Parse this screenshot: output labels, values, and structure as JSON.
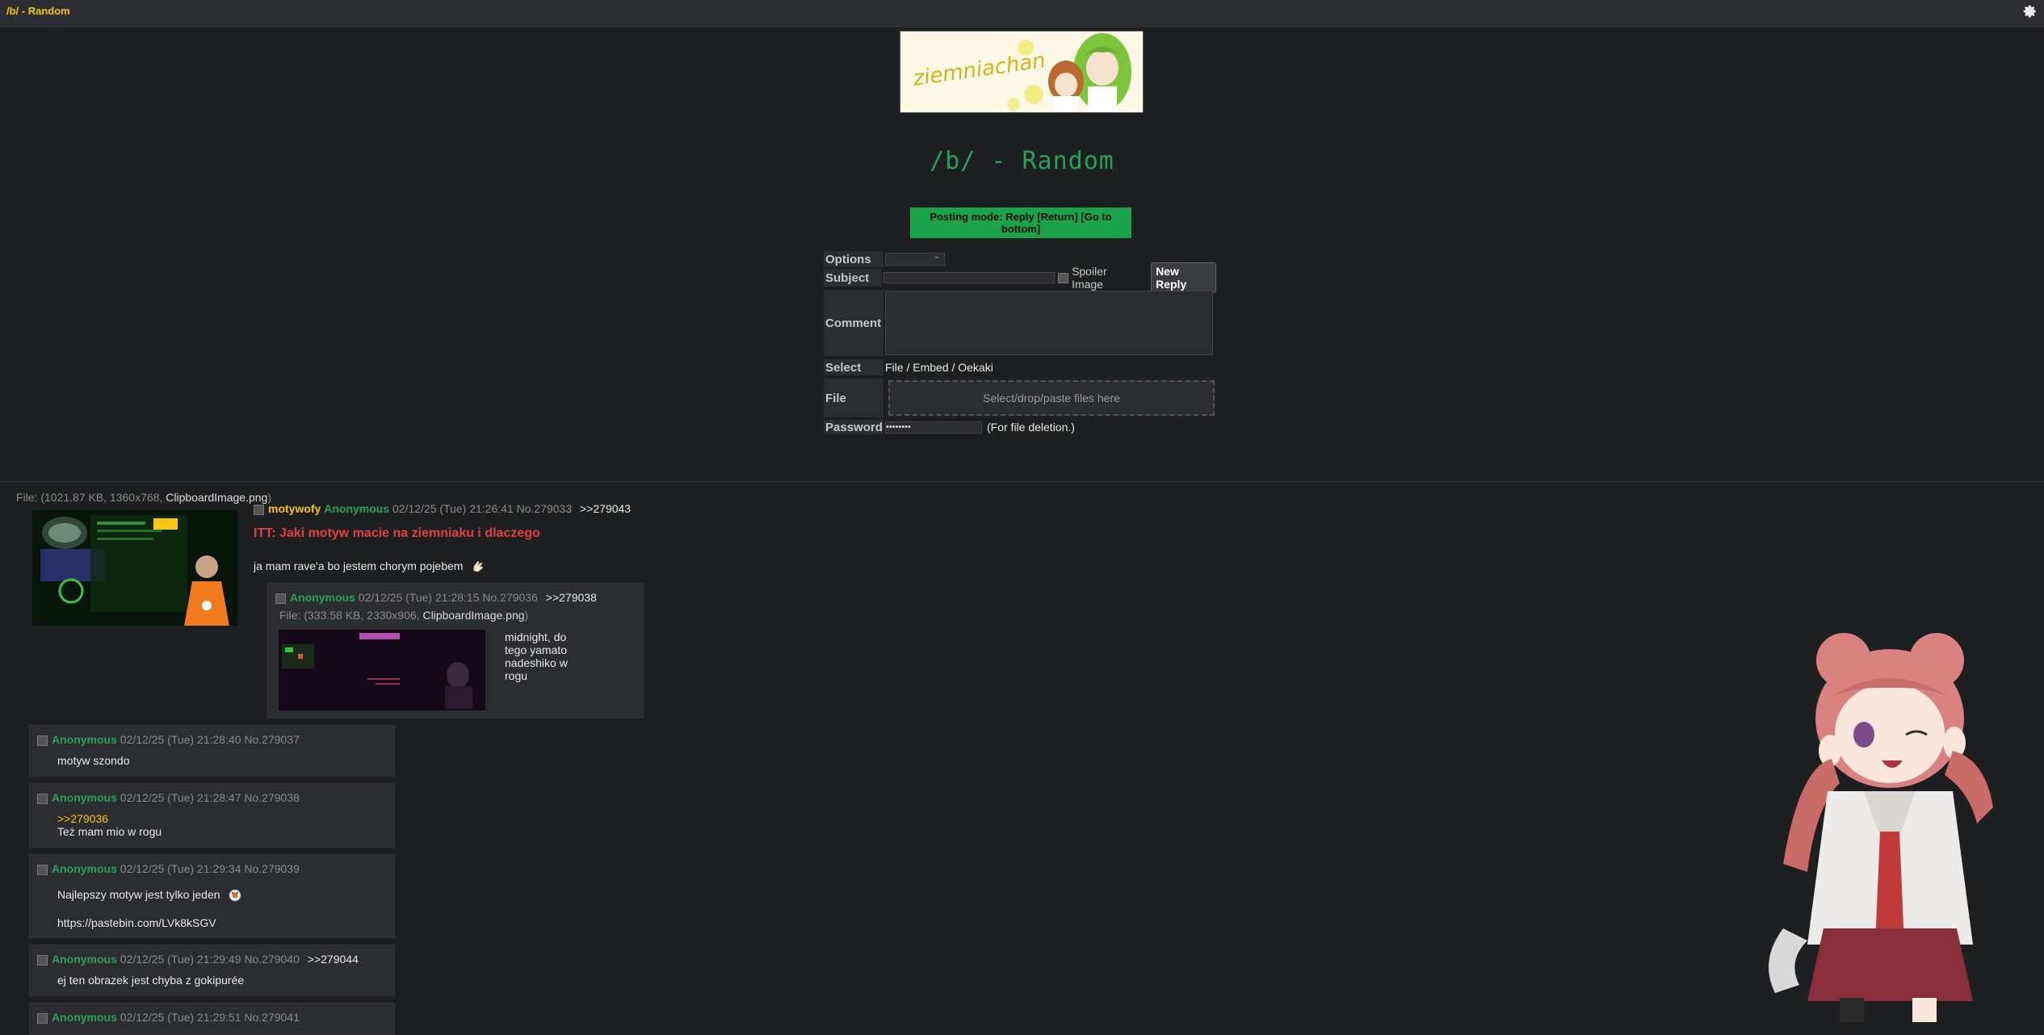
{
  "topbar": {
    "board_link": "/b/ - Random"
  },
  "banner": {
    "alt": "ziemniachan"
  },
  "board_title": "/b/ - Random",
  "posting_mode": {
    "label": "Posting mode: Reply",
    "return": "[Return]",
    "bottom": "[Go to bottom]"
  },
  "form": {
    "options_label": "Options",
    "subject_label": "Subject",
    "spoiler_label": "Spoiler Image",
    "submit_label": "New Reply",
    "comment_label": "Comment",
    "select_label": "Select",
    "select_links": "File / Embed / Oekaki",
    "file_label": "File",
    "dropzone_text": "Select/drop/paste files here",
    "password_label": "Password",
    "password_value": "••••••••",
    "password_note": "(For file deletion.)"
  },
  "op": {
    "file_prefix": "File: (1021.87 KB, 1360x768, ",
    "file_name": "ClipboardImage.png",
    "file_suffix": ")",
    "tripname": "motywofy",
    "name": "Anonymous",
    "date": "02/12/25 (Tue) 21:26:41",
    "no": "No.279033",
    "backlink": ">>279043",
    "subject": "ITT: Jaki motyw macie na ziemniaku i dlaczego",
    "text": "ja mam rave'a bo jestem chorym pojebem"
  },
  "replies": [
    {
      "name": "Anonymous",
      "date": "02/12/25 (Tue) 21:28:15",
      "no": "No.279036",
      "backlink": ">>279038",
      "file_prefix": "File: (333.58 KB, 2330x906, ",
      "file_name": "ClipboardImage.png",
      "file_suffix": ")",
      "lines": [
        "midnight, do",
        "tego yamato",
        "nadeshiko w",
        "rogu"
      ]
    },
    {
      "name": "Anonymous",
      "date": "02/12/25 (Tue) 21:28:40",
      "no": "No.279037",
      "text": "motyw szondo"
    },
    {
      "name": "Anonymous",
      "date": "02/12/25 (Tue) 21:28:47",
      "no": "No.279038",
      "quote": ">>279036",
      "text": "Też mam mio w rogu"
    },
    {
      "name": "Anonymous",
      "date": "02/12/25 (Tue) 21:29:34",
      "no": "No.279039",
      "text": "Najlepszy motyw jest tylko jeden",
      "link": "https://pastebin.com/LVk8kSGV"
    },
    {
      "name": "Anonymous",
      "date": "02/12/25 (Tue) 21:29:49",
      "no": "No.279040",
      "backlink": ">>279044",
      "text": "ej ten obrazek jest chyba z gokipurée"
    },
    {
      "name": "Anonymous",
      "date": "02/12/25 (Tue) 21:29:51",
      "no": "No.279041"
    }
  ],
  "colors": {
    "accent": "#1aa34a",
    "name": "#2aa05a",
    "quote": "#f5c518",
    "subject": "#e04040",
    "bg": "#1d1f21",
    "panel": "#2b2d30"
  }
}
